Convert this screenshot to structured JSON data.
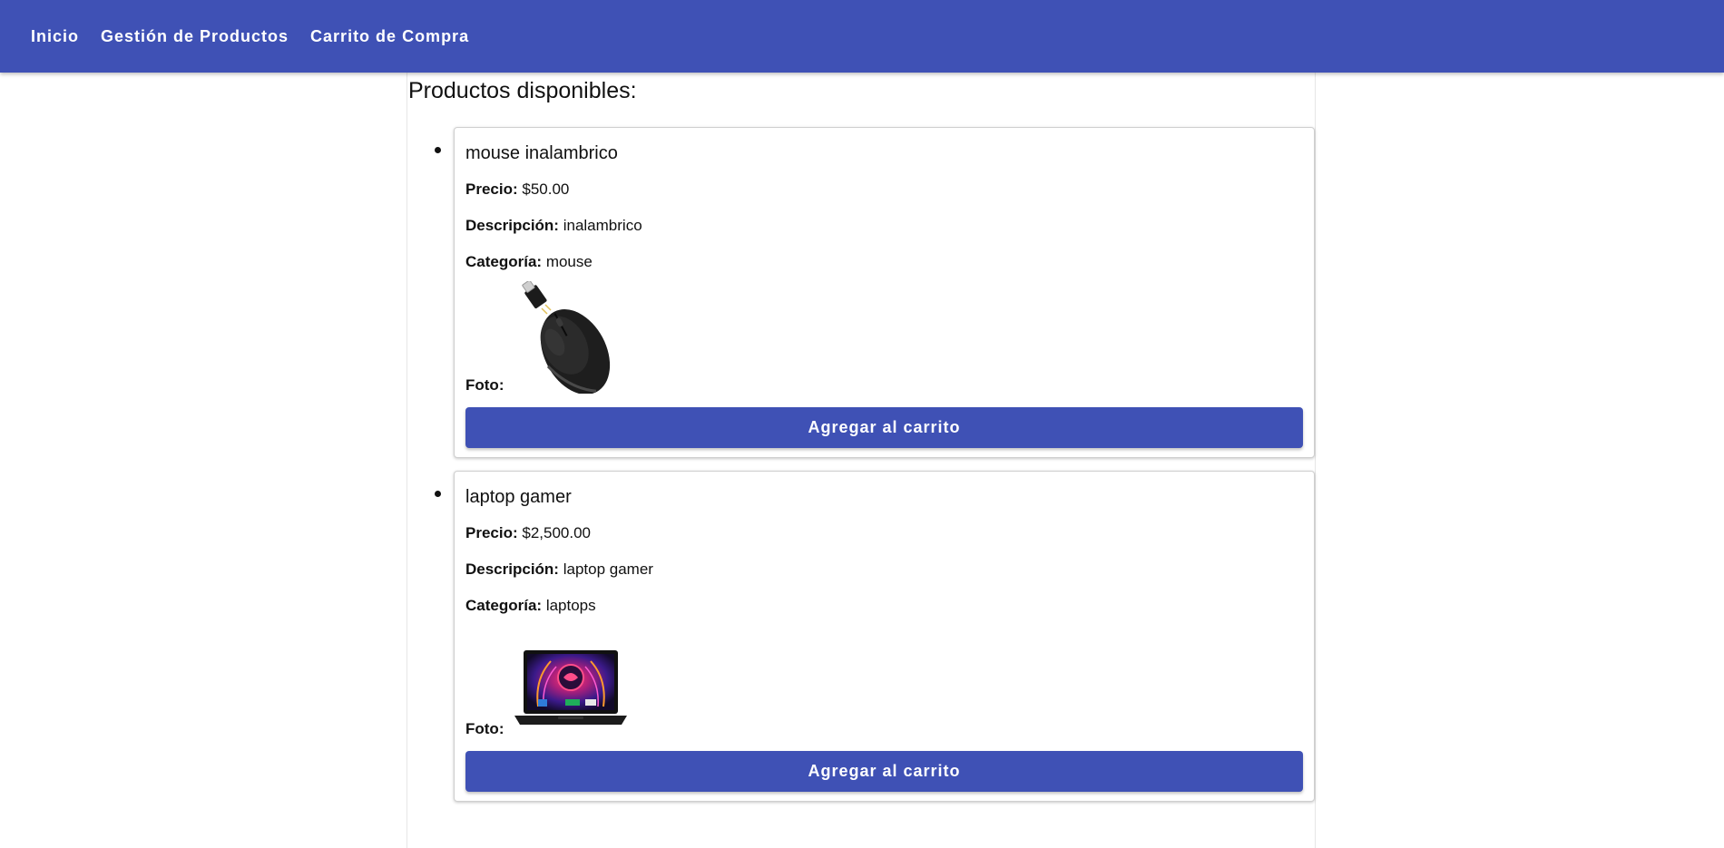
{
  "nav": {
    "items": [
      {
        "label": "Inicio"
      },
      {
        "label": "Gestión de Productos"
      },
      {
        "label": "Carrito de Compra"
      }
    ]
  },
  "main": {
    "title": "Productos disponibles:",
    "labels": {
      "price": "Precio:",
      "description": "Descripción:",
      "category": "Categoría:",
      "photo": "Foto:"
    },
    "button_label": "Agregar al carrito",
    "products": [
      {
        "name": "mouse inalambrico",
        "price": "$50.00",
        "description": "inalambrico",
        "category": "mouse",
        "image_icon": "wireless-mouse-icon"
      },
      {
        "name": "laptop gamer",
        "price": "$2,500.00",
        "description": "laptop gamer",
        "category": "laptops",
        "image_icon": "gaming-laptop-icon"
      }
    ]
  },
  "colors": {
    "primary": "#3f51b5",
    "text": "#111111",
    "card_border": "#cfcfcf"
  }
}
